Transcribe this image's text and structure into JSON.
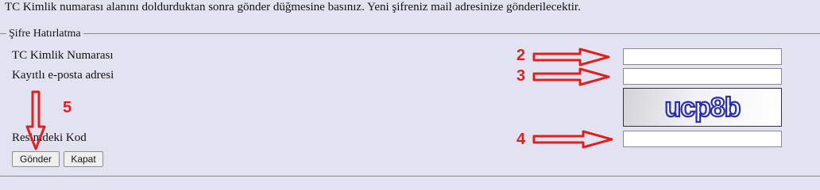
{
  "intro_text": "TC Kimlik numarası alanını doldurduktan sonra gönder düğmesine basınız. Yeni şifreniz mail adresinize gönderilecektir.",
  "fieldset": {
    "legend": "Şifre Hatırlatma",
    "tc_label": "TC Kimlik Numarası",
    "email_label": "Kayıtlı e-posta adresi",
    "code_label": "Resimdeki Kod",
    "tc_value": "",
    "email_value": "",
    "code_value": ""
  },
  "captcha": {
    "text": "ucp8b",
    "color": "#2a2fa8"
  },
  "buttons": {
    "submit": "Gönder",
    "close": "Kapat"
  },
  "annotations": {
    "n2": "2",
    "n3": "3",
    "n4": "4",
    "n5": "5",
    "color": "#e02020",
    "arrow_icon": "right-arrow-outline-icon",
    "down_arrow_icon": "down-arrow-outline-icon"
  }
}
